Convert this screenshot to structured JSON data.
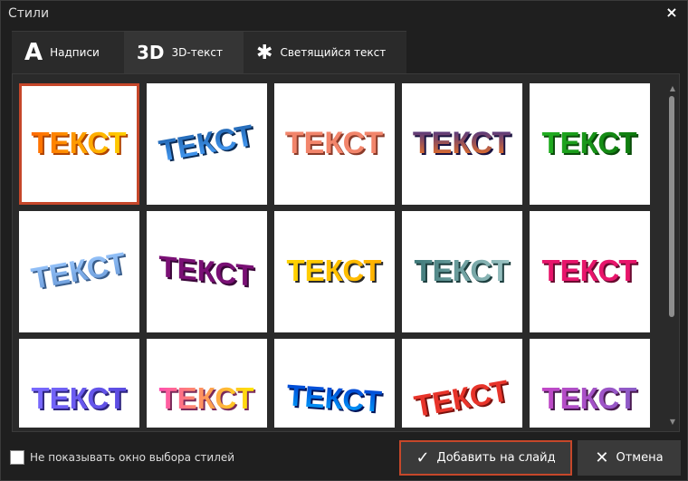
{
  "window": {
    "title": "Стили",
    "close_glyph": "×"
  },
  "tabs": [
    {
      "icon": "A",
      "icon_name": "letter-a-icon",
      "label": "Надписи",
      "active": false
    },
    {
      "icon": "3D",
      "icon_name": "3d-text-icon",
      "label": "3D-текст",
      "active": true
    },
    {
      "icon": "✱",
      "icon_name": "sparkle-icon",
      "label": "Светящийся текст",
      "active": false
    }
  ],
  "styles": [
    {
      "text": "ТЕКСТ",
      "fill": [
        "#ff6a00",
        "#ffd200"
      ],
      "stroke": "#b14500",
      "effect": "flat",
      "selected": true
    },
    {
      "text": "ТЕКСТ",
      "fill": [
        "#1c5ea8",
        "#4aa3ff"
      ],
      "stroke": "#0c2c56",
      "effect": "arc-up",
      "selected": false
    },
    {
      "text": "ТЕКСТ",
      "fill": [
        "#f2856b",
        "#f2856b"
      ],
      "stroke": "#8a3b2a",
      "effect": "arch",
      "selected": false
    },
    {
      "text": "ТЕКСТ",
      "fill": [
        "#3a2d8f",
        "#ff7a1a"
      ],
      "stroke": "#1a1240",
      "effect": "arch",
      "selected": false
    },
    {
      "text": "ТЕКСТ",
      "fill": [
        "#22b022",
        "#0e7a0e"
      ],
      "stroke": "#0a4d0a",
      "effect": "flat",
      "selected": false
    },
    {
      "text": "ТЕКСТ",
      "fill": [
        "#9cc9ff",
        "#6a9ad8"
      ],
      "stroke": "#3a5e8c",
      "effect": "arc-up",
      "selected": false
    },
    {
      "text": "ТЕКСТ",
      "fill": [
        "#7a1075",
        "#7a1075"
      ],
      "stroke": "#3a0638",
      "effect": "slant-down",
      "selected": false
    },
    {
      "text": "ТЕКСТ",
      "fill": [
        "#ffd400",
        "#ffb000"
      ],
      "stroke": "#2a2a2a",
      "effect": "flat",
      "selected": false
    },
    {
      "text": "ТЕКСТ",
      "fill": [
        "#3f7a7a",
        "#9cc4c4"
      ],
      "stroke": "#1e4040",
      "effect": "flat",
      "selected": false
    },
    {
      "text": "ТЕКСТ",
      "fill": [
        "#e8156b",
        "#e8156b"
      ],
      "stroke": "#6a0a30",
      "effect": "flat",
      "selected": false
    },
    {
      "text": "ТЕКСТ",
      "fill": [
        "#7a6bff",
        "#5a4be0"
      ],
      "stroke": "#2e2580",
      "effect": "flat",
      "selected": false
    },
    {
      "text": "ТЕКСТ",
      "fill": [
        "#ff4fb0",
        "#ffe600"
      ],
      "stroke": "#7a2a5a",
      "effect": "flat",
      "selected": false
    },
    {
      "text": "ТЕКСТ",
      "fill": [
        "#0033cc",
        "#00a8ff"
      ],
      "stroke": "#00155a",
      "effect": "wave",
      "selected": false
    },
    {
      "text": "ТЕКСТ",
      "fill": [
        "#e8342a",
        "#e8342a"
      ],
      "stroke": "#7a120e",
      "effect": "arc-up",
      "selected": false
    },
    {
      "text": "ТЕКСТ",
      "fill": [
        "#c247c7",
        "#8a5cc7"
      ],
      "stroke": "#4a1a50",
      "effect": "flat",
      "selected": false
    }
  ],
  "footer": {
    "checkbox_label": "Не показывать окно выбора стилей",
    "checkbox_checked": false,
    "add_button": {
      "icon": "✓",
      "label": "Добавить на слайд"
    },
    "cancel_button": {
      "icon": "✕",
      "label": "Отмена"
    }
  },
  "colors": {
    "accent": "#c6472a",
    "background": "#1f1f1f",
    "panel": "#2a2a2a"
  }
}
